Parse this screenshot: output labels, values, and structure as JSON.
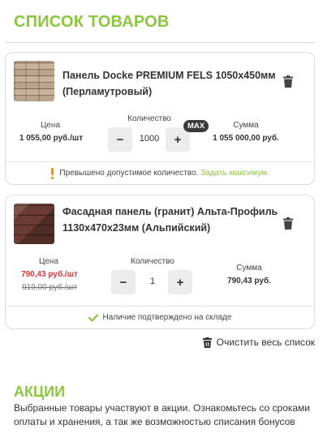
{
  "page": {
    "title": "СПИСОК ТОВАРОВ"
  },
  "labels": {
    "price": "Цена",
    "quantity": "Количество",
    "sum": "Сумма",
    "minus": "−",
    "plus": "+"
  },
  "items": [
    {
      "title": "Панель Docke PREMIUM FELS 1050x450мм (Перламутровый)",
      "price": "1 055,00 руб./шт",
      "quantity": "1000",
      "max_badge": "MAX",
      "sum": "1 055 000,00 руб.",
      "footer_icon": "warning-exclamation-icon",
      "footer_text": "Превышено допустимое количество.",
      "footer_link": "Задать максимум."
    },
    {
      "title": "Фасадная панель (гранит) Альта-Профиль 1130x470x23мм (Альпийский)",
      "price": "790,43 руб./шт",
      "old_price": "919,00 руб./шт",
      "quantity": "1",
      "sum": "790,43 руб.",
      "footer_icon": "check-icon",
      "footer_text": "Наличие подтверждено на складе"
    }
  ],
  "actions": {
    "clear_list": "Очистить весь список"
  },
  "promo": {
    "title": "АКЦИИ",
    "text": "Выбранные товары участвуют в акции. Ознакомьтесь со сроками оплаты и хранения, а так же возможностью списания бонусов"
  },
  "colors": {
    "accent": "#8cc63f",
    "warning": "#f29400",
    "sale": "#e2343a",
    "badge": "#3a3a3a"
  }
}
